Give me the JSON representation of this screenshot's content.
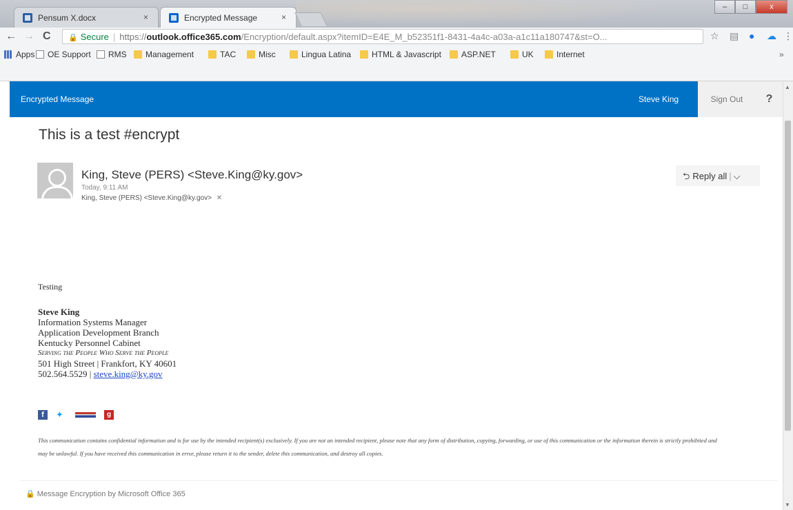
{
  "browser": {
    "tabs": [
      {
        "label": "Pensum X.docx",
        "close": "×"
      },
      {
        "label": "Encrypted Message",
        "close": "×"
      }
    ],
    "window_controls": {
      "minimize": "–",
      "maximize": "□",
      "close": "x"
    },
    "nav": {
      "back": "←",
      "forward": "→",
      "reload": "C"
    },
    "address": {
      "secure_label": "Secure",
      "scheme": "https://",
      "host": "outlook.office365.com",
      "path": "/Encryption/default.aspx?itemID=E4E_M_b52351f1-8431-4a4c-a03a-a1c11a180747&st=O..."
    },
    "bookmarks": [
      {
        "label": "Apps",
        "type": "apps"
      },
      {
        "label": "OE Support",
        "type": "page"
      },
      {
        "label": "RMS",
        "type": "page"
      },
      {
        "label": "Management",
        "type": "folder"
      },
      {
        "label": "TAC",
        "type": "folder"
      },
      {
        "label": "Misc",
        "type": "folder"
      },
      {
        "label": "Lingua Latina",
        "type": "folder"
      },
      {
        "label": "HTML & Javascript",
        "type": "folder"
      },
      {
        "label": "ASP.NET",
        "type": "folder"
      },
      {
        "label": "UK",
        "type": "folder"
      },
      {
        "label": "Internet",
        "type": "folder"
      }
    ],
    "bookmarks_more": "»"
  },
  "owa": {
    "title": "Encrypted Message",
    "user": "Steve King",
    "signout": "Sign Out",
    "help": "?"
  },
  "message": {
    "subject": "This is a test #encrypt",
    "sender": "King, Steve (PERS) <Steve.King@ky.gov>",
    "time": "Today, 9:11 AM",
    "to": "King, Steve (PERS) <Steve.King@ky.gov>",
    "to_remove": "✕",
    "reply_all": "Reply all",
    "reply_all_icon": "reply-all-icon",
    "body_text": "Testing",
    "signature": {
      "name": "Steve King",
      "title": "Information Systems Manager",
      "branch": "Application Development Branch",
      "org": "Kentucky Personnel Cabinet",
      "motto": "Serving the People Who Serve the People",
      "address": "501 High Street | Frankfort, KY  40601",
      "phone": "502.564.5529 | ",
      "email": "steve.king@ky.gov"
    },
    "social": {
      "facebook": "f",
      "twitter": "✦",
      "google": "g"
    },
    "disclaimer": "This communication contains confidential information and is for use by the intended recipient(s) exclusively. If you are not an intended recipient, please note that any form of distribution, copying, forwarding, or use of this communication or the information therein is strictly prohibited and may be unlawful. If you have received this communication in error, please return it to the sender, delete this communication, and destroy all copies."
  },
  "footer": {
    "text": "Message Encryption by Microsoft Office 365"
  },
  "colors": {
    "owa_blue": "#0072c6",
    "link": "#1b45c9"
  }
}
